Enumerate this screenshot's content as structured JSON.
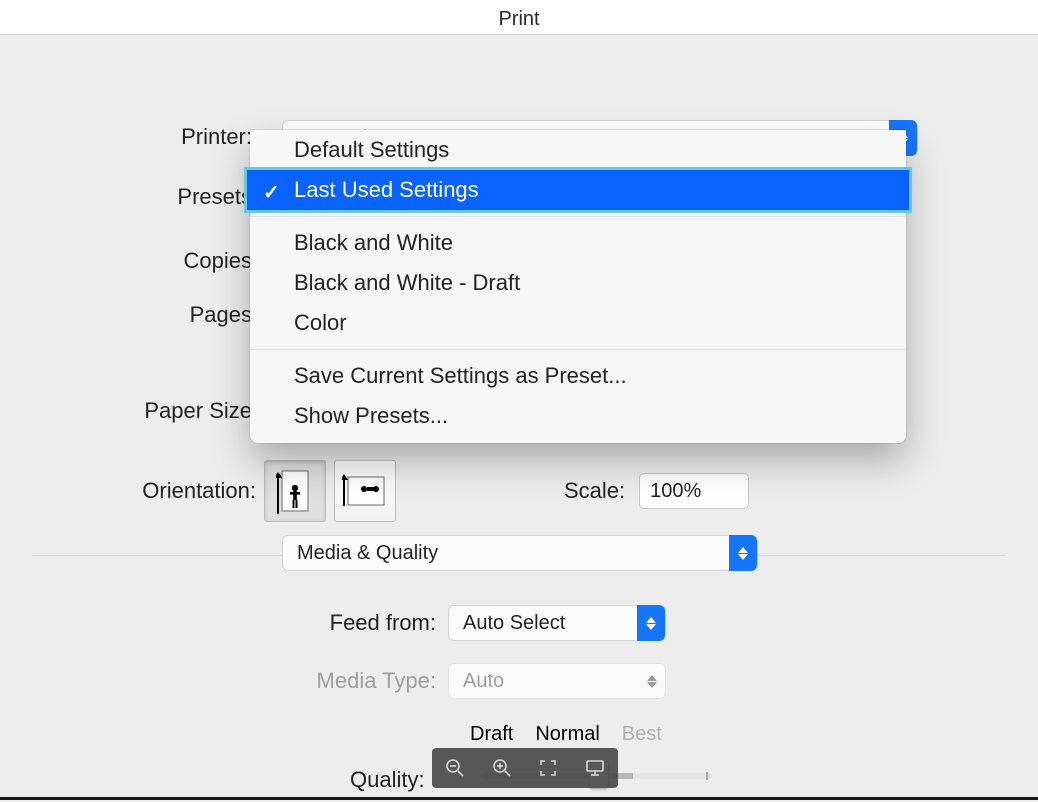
{
  "title": "Print",
  "labels": {
    "printer": "Printer:",
    "presets": "Presets",
    "copies": "Copies",
    "pages": "Pages",
    "paperSize": "Paper Size",
    "orientation": "Orientation:",
    "scale": "Scale:",
    "feedFrom": "Feed from:",
    "mediaType": "Media Type:",
    "quality": "Quality:"
  },
  "printer": {
    "selected": "WeWork"
  },
  "presetsMenu": {
    "group1": [
      "Default Settings",
      "Last Used Settings"
    ],
    "selected": "Last Used Settings",
    "group2": [
      "Black and White",
      "Black and White - Draft",
      "Color"
    ],
    "group3": [
      "Save Current Settings as Preset...",
      "Show Presets..."
    ]
  },
  "scale": {
    "value": "100%"
  },
  "section": {
    "value": "Media & Quality"
  },
  "feed": {
    "value": "Auto Select"
  },
  "media": {
    "value": "Auto"
  },
  "quality": {
    "options": [
      "Draft",
      "Normal",
      "Best"
    ]
  }
}
